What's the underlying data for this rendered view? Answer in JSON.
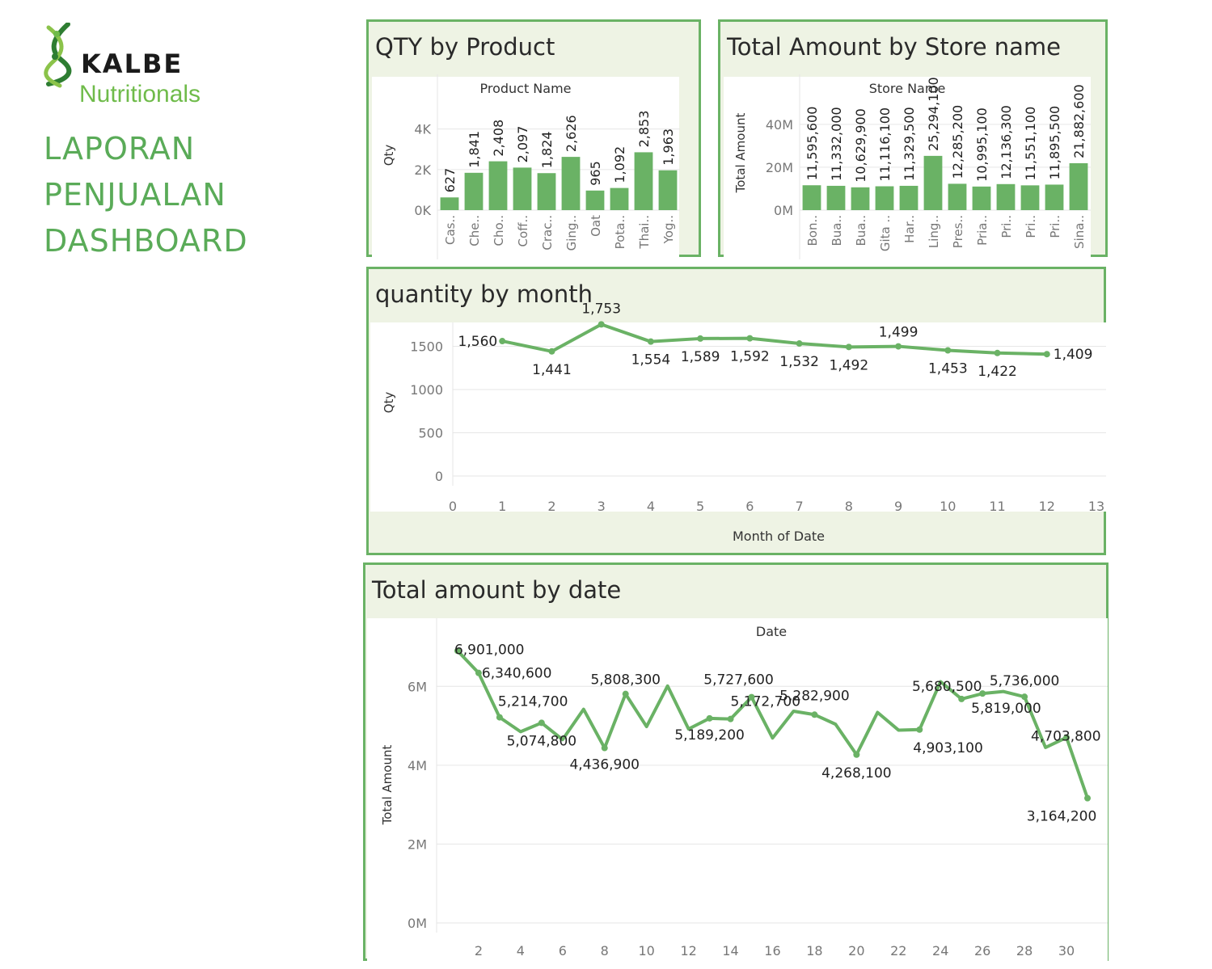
{
  "logo": {
    "brand": "KALBE",
    "sub": "Nutritionals"
  },
  "dashboard_title": [
    "LAPORAN",
    "PENJUALAN",
    "DASHBOARD"
  ],
  "colors": {
    "accent": "#6ab265",
    "panel_bg": "#eef3e4",
    "title": "#5aab58",
    "grid": "#e6e6e6"
  },
  "chart_data": [
    {
      "id": "qty_by_product",
      "type": "bar",
      "title": "QTY by Product",
      "header": "Product Name",
      "ylabel": "Qty",
      "ylim": [
        0,
        5500
      ],
      "yticks": [
        0,
        2000,
        4000
      ],
      "ytick_labels": [
        "0K",
        "2K",
        "4K"
      ],
      "categories": [
        "Cas..",
        "Che..",
        "Cho..",
        "Coff..",
        "Crac..",
        "Ging..",
        "Oat",
        "Pota..",
        "Thai..",
        "Yog.."
      ],
      "values": [
        627,
        1841,
        2408,
        2097,
        1824,
        2626,
        965,
        1092,
        2853,
        1963
      ],
      "value_labels": [
        "627",
        "1,841",
        "2,408",
        "2,097",
        "1,824",
        "2,626",
        "965",
        "1,092",
        "2,853",
        "1,963"
      ]
    },
    {
      "id": "amount_by_store",
      "type": "bar",
      "title": "Total Amount by Store name",
      "header": "Store Name",
      "ylabel": "Total Amount",
      "ylim": [
        0,
        52000000
      ],
      "yticks": [
        0,
        20000000,
        40000000
      ],
      "ytick_labels": [
        "0M",
        "20M",
        "40M"
      ],
      "categories": [
        "Bon..",
        "Bua..",
        "Bua..",
        "Gita ..",
        "Har..",
        "Ling..",
        "Pres..",
        "Pria..",
        "Pri..",
        "Pri..",
        "Pri..",
        "Sina.."
      ],
      "values": [
        11595600,
        11332000,
        10629900,
        11116100,
        11329500,
        25294100,
        12285200,
        10995100,
        12136300,
        11551100,
        11895500,
        21882600
      ],
      "value_labels": [
        "11,595,600",
        "11,332,000",
        "10,629,900",
        "11,116,100",
        "11,329,500",
        "25,294,100",
        "12,285,200",
        "10,995,100",
        "12,136,300",
        "11,551,100",
        "11,895,500",
        "21,882,600"
      ]
    },
    {
      "id": "qty_by_month",
      "type": "line",
      "title": "quantity by month",
      "xlabel": "Month of Date",
      "ylabel": "Qty",
      "xlim": [
        0,
        13
      ],
      "ylim": [
        0,
        1850
      ],
      "xticks": [
        0,
        1,
        2,
        3,
        4,
        5,
        6,
        7,
        8,
        9,
        10,
        11,
        12,
        13
      ],
      "yticks": [
        0,
        500,
        1000,
        1500
      ],
      "x": [
        1,
        2,
        3,
        4,
        5,
        6,
        7,
        8,
        9,
        10,
        11,
        12
      ],
      "values": [
        1560,
        1441,
        1753,
        1554,
        1589,
        1592,
        1532,
        1492,
        1499,
        1453,
        1422,
        1409
      ],
      "value_labels": [
        "1,560",
        "1,441",
        "1,753",
        "1,554",
        "1,589",
        "1,592",
        "1,532",
        "1,492",
        "1,499",
        "1,453",
        "1,422",
        "1,409"
      ]
    },
    {
      "id": "amount_by_date",
      "type": "line",
      "title": "Total amount by date",
      "header": "Date",
      "ylabel": "Total Amount",
      "xlim": [
        0,
        31.5
      ],
      "ylim": [
        0,
        7400000
      ],
      "xticks": [
        2,
        4,
        6,
        8,
        10,
        12,
        14,
        16,
        18,
        20,
        22,
        24,
        26,
        28,
        30
      ],
      "yticks": [
        0,
        2000000,
        4000000,
        6000000
      ],
      "ytick_labels": [
        "0M",
        "2M",
        "4M",
        "6M"
      ],
      "x": [
        1,
        2,
        3,
        4,
        5,
        6,
        7,
        8,
        9,
        10,
        11,
        12,
        13,
        14,
        15,
        16,
        17,
        18,
        19,
        20,
        21,
        22,
        23,
        24,
        25,
        26,
        27,
        28,
        29,
        30,
        31
      ],
      "values": [
        6901000,
        6340600,
        5214700,
        4850000,
        5074800,
        4650000,
        5420000,
        4436900,
        5808300,
        4980000,
        6010000,
        4920000,
        5189200,
        5172700,
        5727600,
        4690000,
        5370000,
        5282900,
        5040000,
        4268100,
        5340000,
        4890000,
        4903100,
        6120000,
        5680500,
        5819000,
        5870000,
        5736000,
        4450000,
        4703800,
        3164200
      ],
      "labels": [
        {
          "i": 0,
          "text": "6,901,000"
        },
        {
          "i": 1,
          "text": "6,340,600"
        },
        {
          "i": 2,
          "text": "5,214,700"
        },
        {
          "i": 4,
          "text": "5,074,800"
        },
        {
          "i": 7,
          "text": "4,436,900"
        },
        {
          "i": 8,
          "text": "5,808,300"
        },
        {
          "i": 12,
          "text": "5,189,200"
        },
        {
          "i": 13,
          "text": "5,172,700"
        },
        {
          "i": 14,
          "text": "5,727,600"
        },
        {
          "i": 17,
          "text": "5,282,900"
        },
        {
          "i": 19,
          "text": "4,268,100"
        },
        {
          "i": 22,
          "text": "4,903,100"
        },
        {
          "i": 24,
          "text": "5,680,500"
        },
        {
          "i": 25,
          "text": "5,819,000"
        },
        {
          "i": 27,
          "text": "5,736,000"
        },
        {
          "i": 29,
          "text": "4,703,800"
        },
        {
          "i": 30,
          "text": "3,164,200"
        }
      ]
    }
  ]
}
